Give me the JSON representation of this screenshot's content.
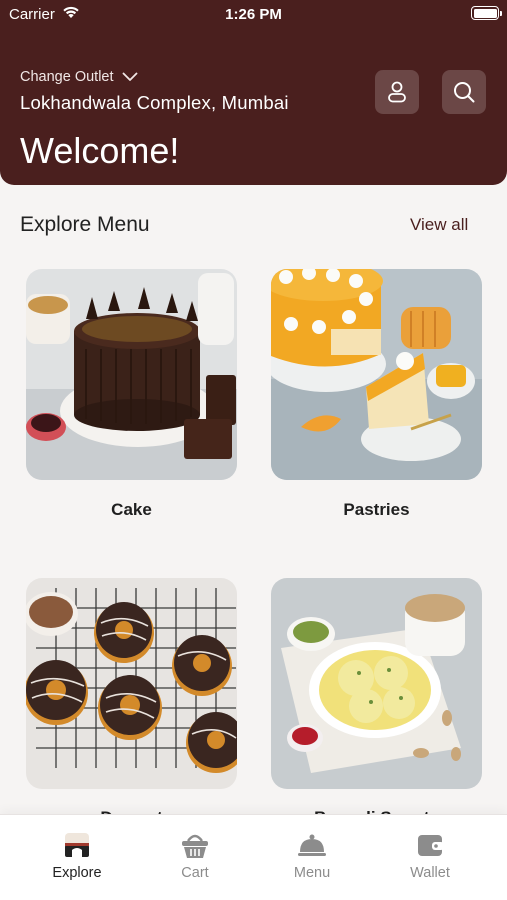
{
  "status_bar": {
    "carrier": "Carrier",
    "time": "1:26 PM"
  },
  "header": {
    "change_outlet_label": "Change Outlet",
    "outlet_name": "Lokhandwala Complex, Mumbai",
    "welcome": "Welcome!"
  },
  "explore": {
    "title": "Explore Menu",
    "view_all": "View all",
    "categories": [
      {
        "label": "Cake"
      },
      {
        "label": "Pastries"
      },
      {
        "label": "Dessert"
      },
      {
        "label": "Bengali Sweets"
      }
    ]
  },
  "tabs": [
    {
      "label": "Explore",
      "active": true
    },
    {
      "label": "Cart",
      "active": false
    },
    {
      "label": "Menu",
      "active": false
    },
    {
      "label": "Wallet",
      "active": false
    }
  ],
  "colors": {
    "brand": "#4a1f1e",
    "header_button": "#6b4746",
    "background": "#f6f4f3",
    "inactive_tab": "#8c8c8c"
  }
}
